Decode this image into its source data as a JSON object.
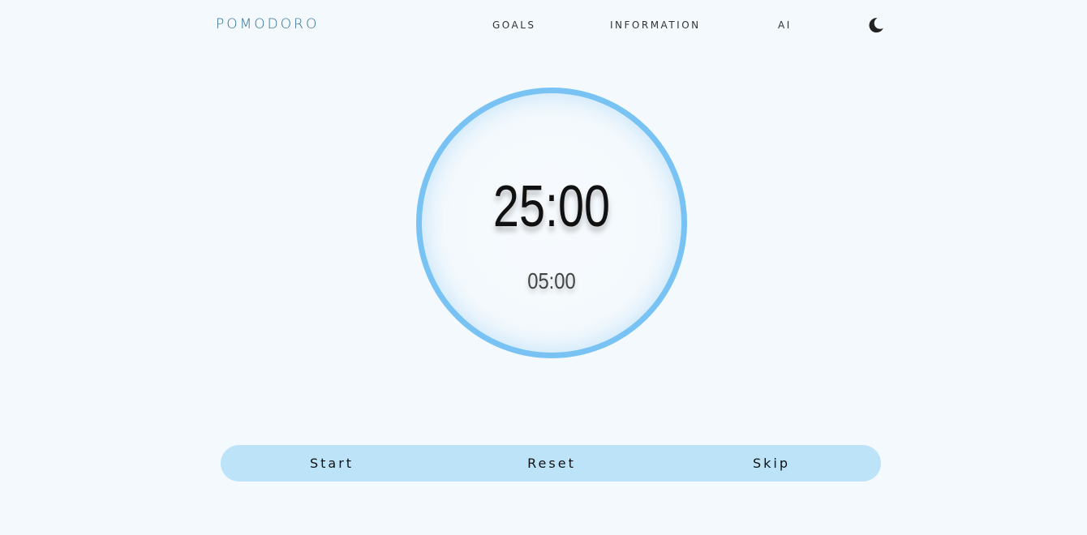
{
  "app": {
    "brand": "POMODORO"
  },
  "nav": {
    "goals": "GOALS",
    "information": "INFORMATION",
    "ai": "AI",
    "theme_toggle_icon": "moon-icon"
  },
  "timer": {
    "main_time": "25:00",
    "break_time": "05:00"
  },
  "controls": {
    "start": "Start",
    "reset": "Reset",
    "skip": "Skip"
  },
  "colors": {
    "background": "#f4f9fd",
    "brand": "#2f6f8f",
    "ring": "#78c3f4",
    "controls_bg": "#bde3f9"
  }
}
